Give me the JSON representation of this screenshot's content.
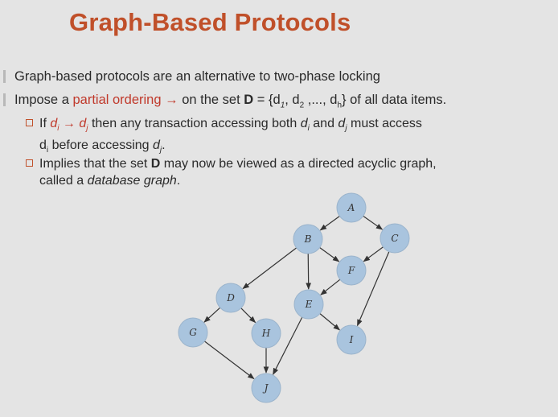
{
  "title": "Graph-Based Protocols",
  "bullets": {
    "b1": "Graph-based protocols are an alternative to two-phase locking",
    "b2_pre": "Impose a ",
    "b2_red": "partial ordering",
    "b2_arrow": " → ",
    "b2_mid": "on the set ",
    "b2_bold": "D",
    "b2_set": " = {d",
    "b2_s1": "1",
    "b2_c1": ", d",
    "b2_s2": "2",
    "b2_c2": " ,..., d",
    "b2_s3": "h",
    "b2_end": "} of all data items."
  },
  "sub1": {
    "pre": "If ",
    "d_i": "d",
    "i": "i",
    "arrow": " → ",
    "d_j": "d",
    "j": "j",
    "mid": "  then any transaction accessing both ",
    "d2": "d",
    "i2": "i",
    "and": " and ",
    "d3": "d",
    "j2": "j",
    "end": " must access",
    "line2_pre": "d",
    "line2_i": "i",
    "line2_mid": " before accessing ",
    "line2_d": "d",
    "line2_j": "j",
    "line2_end": "."
  },
  "sub2": {
    "pre": "Implies that the set ",
    "bold": "D",
    "mid": " may now be viewed as a directed acyclic graph,",
    "line2_pre": "called a ",
    "line2_it": "database graph",
    "line2_end": "."
  },
  "graph": {
    "nodes": [
      {
        "id": "A",
        "label": "A"
      },
      {
        "id": "B",
        "label": "B"
      },
      {
        "id": "C",
        "label": "C"
      },
      {
        "id": "D",
        "label": "D"
      },
      {
        "id": "E",
        "label": "E"
      },
      {
        "id": "F",
        "label": "F"
      },
      {
        "id": "G",
        "label": "G"
      },
      {
        "id": "H",
        "label": "H"
      },
      {
        "id": "I",
        "label": "I"
      },
      {
        "id": "J",
        "label": "J"
      }
    ],
    "edges": [
      [
        "A",
        "B"
      ],
      [
        "A",
        "C"
      ],
      [
        "B",
        "D"
      ],
      [
        "B",
        "E"
      ],
      [
        "B",
        "F"
      ],
      [
        "C",
        "F"
      ],
      [
        "C",
        "I"
      ],
      [
        "D",
        "G"
      ],
      [
        "D",
        "H"
      ],
      [
        "F",
        "E"
      ],
      [
        "E",
        "I"
      ],
      [
        "E",
        "J"
      ],
      [
        "G",
        "J"
      ],
      [
        "H",
        "J"
      ]
    ],
    "node_fill": "#a9c4de",
    "node_stroke": "#9bb4cc"
  }
}
